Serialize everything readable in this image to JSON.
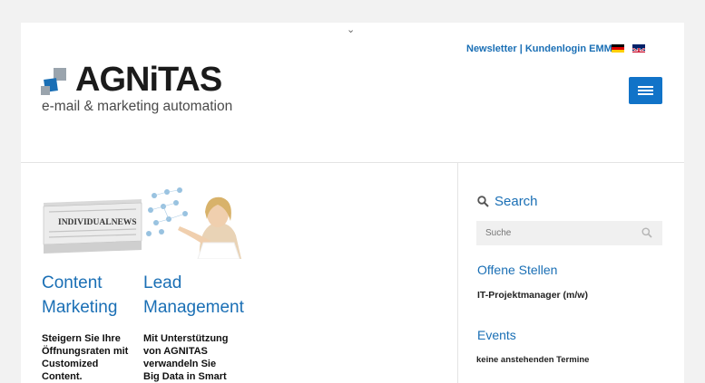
{
  "header": {
    "top_links": [
      "Newsletter",
      "Kundenlogin EMM"
    ],
    "separator": "|",
    "languages": [
      "de",
      "en"
    ],
    "logo": {
      "name": "AGNiTAS",
      "tagline": "e-mail & marketing automation"
    },
    "menu_icon": "hamburger-icon"
  },
  "colors": {
    "accent": "#1a6fb5",
    "menu_button": "#1173c8"
  },
  "teasers": [
    {
      "image_label": "INDIVIDUALNEWS",
      "title_lines": [
        "Content",
        "Marketing"
      ],
      "text_lines": [
        "Steigern Sie Ihre",
        "Öffnungsraten mit",
        "Customized",
        "Content."
      ]
    },
    {
      "title_lines": [
        "Lead",
        "Management"
      ],
      "text_lines": [
        "Mit Unterstützung",
        "von AGNITAS",
        "verwandeln Sie",
        "Big Data in Smart"
      ]
    }
  ],
  "sidebar": {
    "search_title": "Search",
    "search_placeholder": "Suche",
    "jobs_title": "Offene Stellen",
    "job_item": "IT-Projektmanager (m/w)",
    "events_title": "Events",
    "events_text": "keine anstehenden Termine"
  }
}
